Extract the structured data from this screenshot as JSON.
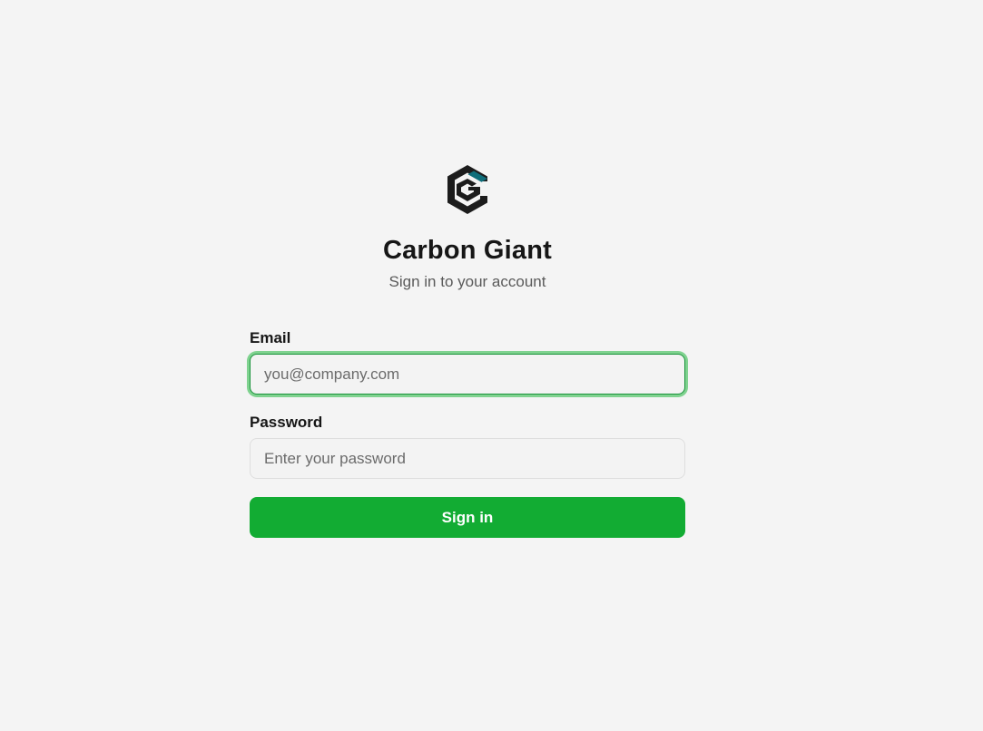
{
  "brand": {
    "logo_icon": "carbon-giant-logo-icon",
    "name": "Carbon Giant",
    "tagline": "Sign in to your account"
  },
  "form": {
    "email": {
      "label": "Email",
      "value": "",
      "placeholder": "you@company.com",
      "focused": true
    },
    "password": {
      "label": "Password",
      "value": "",
      "placeholder": "Enter your password"
    },
    "submit_label": "Sign in"
  },
  "colors": {
    "background": "#f4f4f4",
    "primary": "#12ac33",
    "focus_ring": "#7fd28f",
    "logo_dark": "#1c1c1c",
    "logo_accent": "#0f6e7a"
  }
}
